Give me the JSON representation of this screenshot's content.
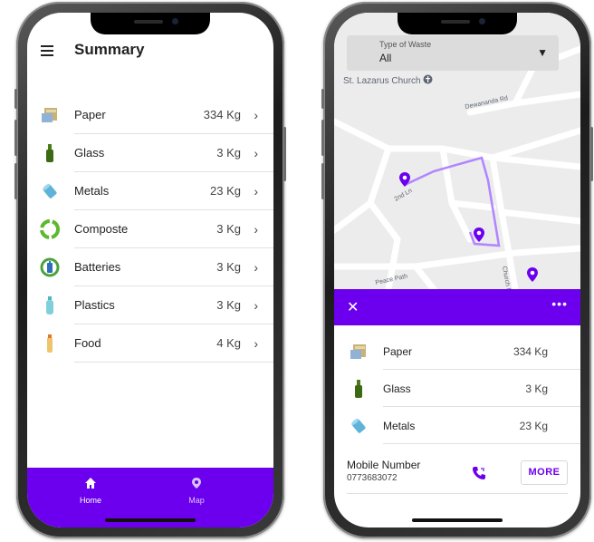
{
  "summary_screen": {
    "title": "Summary",
    "items": [
      {
        "label": "Paper",
        "value": "334 Kg",
        "icon": "paper-icon"
      },
      {
        "label": "Glass",
        "value": "3 Kg",
        "icon": "glass-bottle-icon"
      },
      {
        "label": "Metals",
        "value": "23 Kg",
        "icon": "metal-can-icon"
      },
      {
        "label": "Composte",
        "value": "3 Kg",
        "icon": "recycle-icon"
      },
      {
        "label": "Batteries",
        "value": "3 Kg",
        "icon": "battery-icon"
      },
      {
        "label": "Plastics",
        "value": "3 Kg",
        "icon": "plastic-bottle-icon"
      },
      {
        "label": "Food",
        "value": "4 Kg",
        "icon": "food-icon"
      }
    ],
    "chevron": "›",
    "nav": [
      {
        "label": "Home",
        "icon": "home-icon"
      },
      {
        "label": "Map",
        "icon": "map-pin-icon"
      }
    ]
  },
  "map_screen": {
    "filter": {
      "caption": "Type of Waste",
      "value": "All"
    },
    "map_labels": {
      "church": "St. Lazarus Church",
      "road_1": "Dewananda Rd",
      "road_2": "2nd Ln",
      "road_3": "Church Rd",
      "road_4": "Peace Path"
    },
    "items": [
      {
        "label": "Paper",
        "value": "334 Kg",
        "icon": "paper-icon"
      },
      {
        "label": "Glass",
        "value": "3 Kg",
        "icon": "glass-bottle-icon"
      },
      {
        "label": "Metals",
        "value": "23 Kg",
        "icon": "metal-can-icon"
      }
    ],
    "close_glyph": "✕",
    "more_glyph": "•••",
    "mobile_label": "Mobile Number",
    "mobile_number": "0773683072",
    "more_button": "MORE"
  },
  "colors": {
    "accent": "#6c00ee",
    "route": "#b085ff",
    "divider": "#e1e1e1"
  }
}
